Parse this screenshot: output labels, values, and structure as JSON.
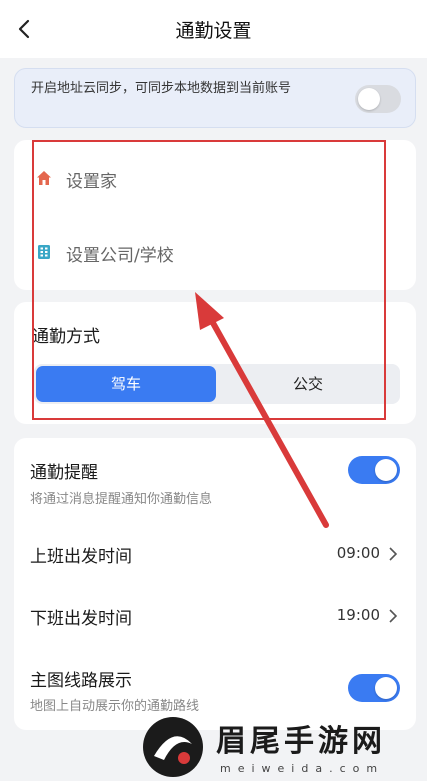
{
  "header": {
    "title": "通勤设置",
    "back_icon": "back-arrow-icon"
  },
  "sync": {
    "text": "开启地址云同步，可同步本地数据到当前账号",
    "enabled": false
  },
  "addresses": [
    {
      "label": "设置家",
      "icon": "home-icon",
      "icon_color": "#e4674e"
    },
    {
      "label": "设置公司/学校",
      "icon": "building-icon",
      "icon_color": "#39a7c6"
    }
  ],
  "commute_mode": {
    "title": "通勤方式",
    "options": [
      "驾车",
      "公交"
    ],
    "selected": "驾车"
  },
  "settings": {
    "reminder": {
      "title": "通勤提醒",
      "subtitle": "将通过消息提醒通知你通勤信息",
      "enabled": true
    },
    "work_time": {
      "title": "上班出发时间",
      "value": "09:00"
    },
    "home_time": {
      "title": "下班出发时间",
      "value": "19:00"
    },
    "route_display": {
      "title": "主图线路展示",
      "subtitle": "地图上自动展示你的通勤路线",
      "enabled": true
    }
  },
  "watermark": {
    "title": "眉尾手游网",
    "url": "meiweida.com"
  },
  "colors": {
    "accent": "#3a7bf2",
    "annotation": "#d93a3a"
  }
}
